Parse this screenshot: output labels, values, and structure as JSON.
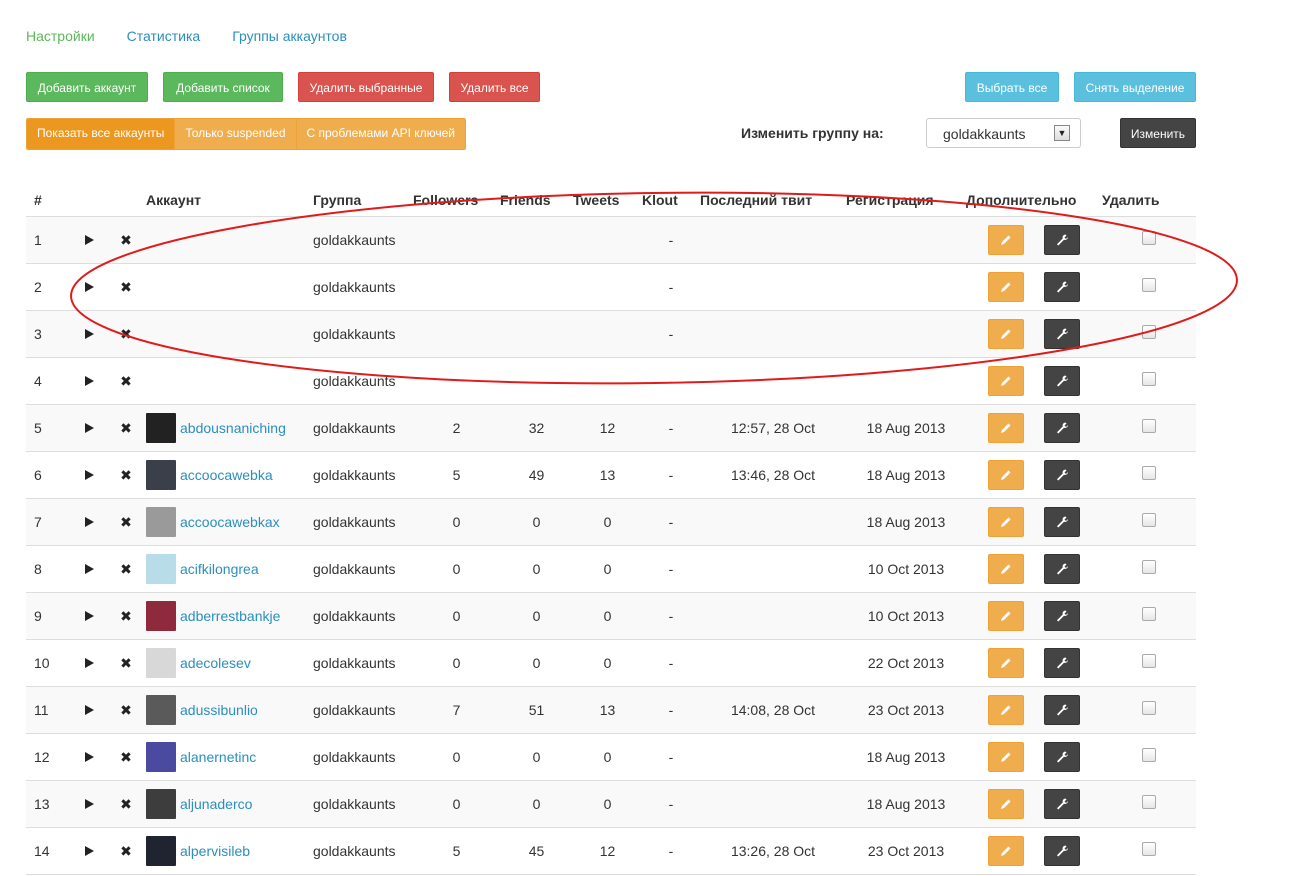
{
  "nav": {
    "settings": "Настройки",
    "stats": "Статистика",
    "groups": "Группы аккаунтов"
  },
  "actions": {
    "add_account": "Добавить аккаунт",
    "add_list": "Добавить список",
    "delete_selected": "Удалить выбранные",
    "delete_all": "Удалить все",
    "select_all": "Выбрать все",
    "deselect": "Снять выделение"
  },
  "filters": {
    "all": "Показать все аккаунты",
    "suspended": "Только suspended",
    "api": "С проблемами API ключей"
  },
  "group_change": {
    "label": "Изменить группу на:",
    "selected": "goldakkaunts",
    "apply": "Изменить"
  },
  "table": {
    "headers": {
      "num": "#",
      "account": "Аккаунт",
      "group": "Группа",
      "followers": "Followers",
      "friends": "Friends",
      "tweets": "Tweets",
      "klout": "Klout",
      "last_tweet": "Последний твит",
      "registered": "Регистрация",
      "extra": "Дополнительно",
      "delete": "Удалить"
    },
    "rows": [
      {
        "n": "1",
        "account": "",
        "group": "goldakkaunts",
        "followers": "",
        "friends": "",
        "tweets": "",
        "klout": "-",
        "last": "",
        "reg": ""
      },
      {
        "n": "2",
        "account": "",
        "group": "goldakkaunts",
        "followers": "",
        "friends": "",
        "tweets": "",
        "klout": "-",
        "last": "",
        "reg": ""
      },
      {
        "n": "3",
        "account": "",
        "group": "goldakkaunts",
        "followers": "",
        "friends": "",
        "tweets": "",
        "klout": "-",
        "last": "",
        "reg": ""
      },
      {
        "n": "4",
        "account": "",
        "group": "goldakkaunts",
        "followers": "",
        "friends": "",
        "tweets": "",
        "klout": "-",
        "last": "",
        "reg": ""
      },
      {
        "n": "5",
        "account": "abdousnaniching",
        "group": "goldakkaunts",
        "followers": "2",
        "friends": "32",
        "tweets": "12",
        "klout": "-",
        "last": "12:57, 28 Oct",
        "reg": "18 Aug 2013",
        "avatar": "#222222"
      },
      {
        "n": "6",
        "account": "accoocawebka",
        "group": "goldakkaunts",
        "followers": "5",
        "friends": "49",
        "tweets": "13",
        "klout": "-",
        "last": "13:46, 28 Oct",
        "reg": "18 Aug 2013",
        "avatar": "#3a3f4a"
      },
      {
        "n": "7",
        "account": "accoocawebkax",
        "group": "goldakkaunts",
        "followers": "0",
        "friends": "0",
        "tweets": "0",
        "klout": "-",
        "last": "",
        "reg": "18 Aug 2013",
        "avatar": "#9a9a9a"
      },
      {
        "n": "8",
        "account": "acifkilongrea",
        "group": "goldakkaunts",
        "followers": "0",
        "friends": "0",
        "tweets": "0",
        "klout": "-",
        "last": "",
        "reg": "10 Oct 2013",
        "avatar": "#b8dde8"
      },
      {
        "n": "9",
        "account": "adberrestbankje",
        "group": "goldakkaunts",
        "followers": "0",
        "friends": "0",
        "tweets": "0",
        "klout": "-",
        "last": "",
        "reg": "10 Oct 2013",
        "avatar": "#8e2a3c"
      },
      {
        "n": "10",
        "account": "adecolesev",
        "group": "goldakkaunts",
        "followers": "0",
        "friends": "0",
        "tweets": "0",
        "klout": "-",
        "last": "",
        "reg": "22 Oct 2013",
        "avatar": "#d8d8d8"
      },
      {
        "n": "11",
        "account": "adussibunlio",
        "group": "goldakkaunts",
        "followers": "7",
        "friends": "51",
        "tweets": "13",
        "klout": "-",
        "last": "14:08, 28 Oct",
        "reg": "23 Oct 2013",
        "avatar": "#5a5a5a"
      },
      {
        "n": "12",
        "account": "alanernetinc",
        "group": "goldakkaunts",
        "followers": "0",
        "friends": "0",
        "tweets": "0",
        "klout": "-",
        "last": "",
        "reg": "18 Aug 2013",
        "avatar": "#4a4aa0"
      },
      {
        "n": "13",
        "account": "aljunaderco",
        "group": "goldakkaunts",
        "followers": "0",
        "friends": "0",
        "tweets": "0",
        "klout": "-",
        "last": "",
        "reg": "18 Aug 2013",
        "avatar": "#3d3d3d"
      },
      {
        "n": "14",
        "account": "alpervisileb",
        "group": "goldakkaunts",
        "followers": "5",
        "friends": "45",
        "tweets": "12",
        "klout": "-",
        "last": "13:26, 28 Oct",
        "reg": "23 Oct 2013",
        "avatar": "#1f2430"
      }
    ]
  },
  "colors": {
    "green": "#5cb85c",
    "red": "#d9534f",
    "blue": "#5bc0de",
    "orange": "#f0ad4e",
    "dark": "#444444",
    "annotation": "#e01b1b"
  }
}
